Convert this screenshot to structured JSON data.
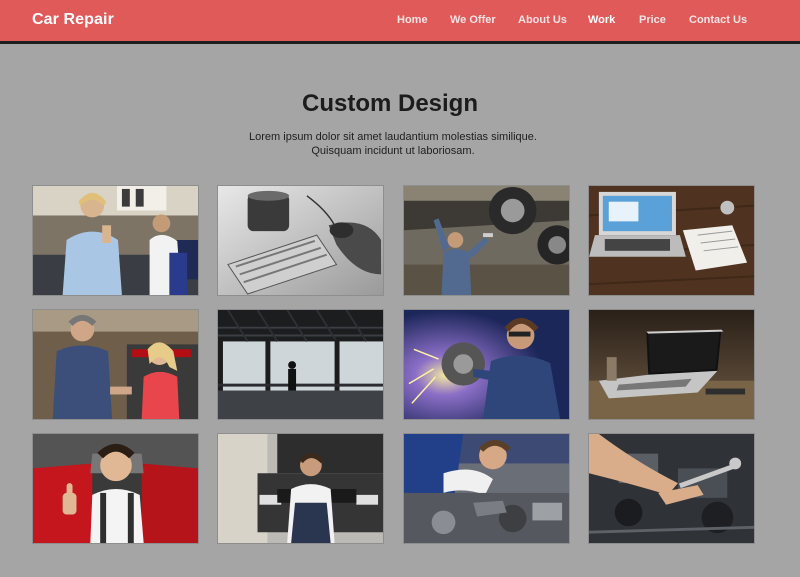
{
  "brand": "Car Repair",
  "nav": {
    "items": [
      "Home",
      "We Offer",
      "About Us",
      "Work",
      "Price",
      "Contact Us"
    ],
    "active": "Work"
  },
  "section": {
    "title": "Custom Design",
    "lead_line1": "Lorem ipsum dolor sit amet laudantium molestias similique.",
    "lead_line2": "Quisquam incidunt ut laboriosam."
  },
  "gallery": {
    "photos": [
      "mechanic-and-customer-on-phone",
      "keyboard-and-mouse",
      "mechanic-under-car",
      "laptop-and-notebook",
      "mechanic-talking-with-customer",
      "silhouette-in-warehouse",
      "mechanic-grinding",
      "laptop-on-desk",
      "mechanic-thumbs-up",
      "mechanic-in-front-of-car",
      "mechanic-under-hood",
      "hands-with-wrench-in-engine"
    ]
  },
  "colors": {
    "navbar": "#e05a5a",
    "navbar_border": "#1e1e1e",
    "page_background": "#a5a5a5",
    "nav_active": "#ffffff",
    "nav_text": "#f4e4e4"
  }
}
